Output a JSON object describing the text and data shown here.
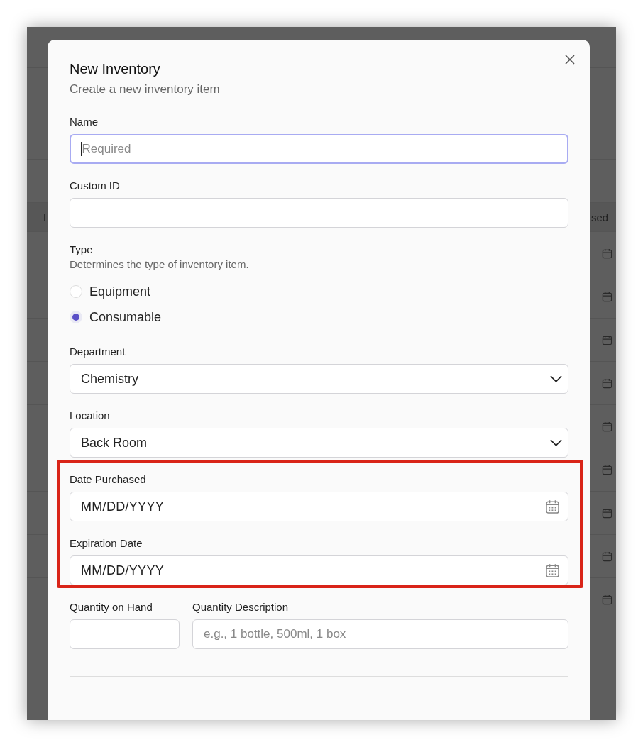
{
  "background_table": {
    "header": {
      "column_1": "L",
      "column_2": "sed"
    }
  },
  "dialog": {
    "title": "New Inventory",
    "subtitle": "Create a new inventory item",
    "fields": [
      {
        "kind": "text",
        "label": "Name",
        "placeholder": "Required",
        "focused": true
      },
      {
        "kind": "text",
        "label": "Custom ID",
        "focused": false
      },
      {
        "kind": "radio",
        "label": "Type",
        "description": "Determines the type of inventory item.",
        "options": [
          {
            "label": "Equipment",
            "selected": false
          },
          {
            "label": "Consumable",
            "selected": true
          }
        ]
      },
      {
        "kind": "select",
        "label": "Department",
        "value": "Chemistry"
      },
      {
        "kind": "select",
        "label": "Location",
        "value": "Back Room"
      }
    ],
    "date_fields": {
      "highlighted": true,
      "fields": [
        {
          "label": "Date Purchased",
          "value": "MM/DD/YYYY"
        },
        {
          "label": "Expiration Date",
          "value": "MM/DD/YYYY"
        }
      ]
    },
    "quantity": [
      {
        "label": "Quantity on Hand"
      },
      {
        "label": "Quantity Description",
        "placeholder": "e.g., 1 bottle, 500ml, 1 box"
      }
    ]
  }
}
